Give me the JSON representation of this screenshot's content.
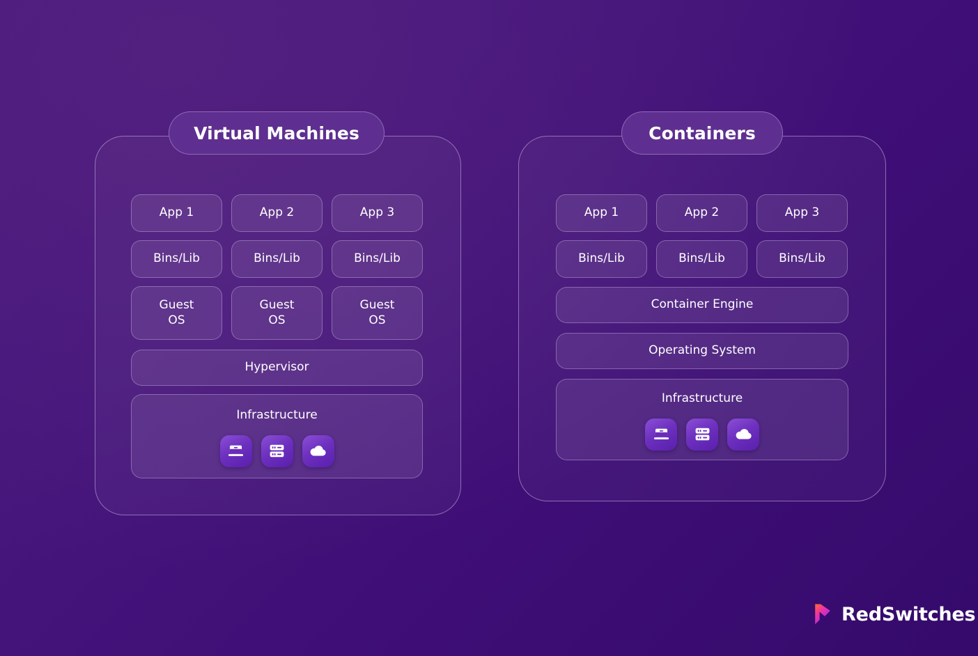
{
  "background": {
    "gradient_from": "#4b1a7e",
    "gradient_to": "#350a6c"
  },
  "panels": [
    {
      "id": "virtual-machines",
      "title": "Virtual Machines",
      "columns": [
        {
          "app": "App 1",
          "bins": "Bins/Lib",
          "guest_os": "Guest\nOS"
        },
        {
          "app": "App 2",
          "bins": "Bins/Lib",
          "guest_os": "Guest\nOS"
        },
        {
          "app": "App 3",
          "bins": "Bins/Lib",
          "guest_os": "Guest\nOS"
        }
      ],
      "hypervisor": "Hypervisor",
      "infrastructure": {
        "label": "Infrastructure",
        "icons": [
          "laptop-icon",
          "server-icon",
          "cloud-icon"
        ]
      }
    },
    {
      "id": "containers",
      "title": "Containers",
      "columns": [
        {
          "app": "App 1",
          "bins": "Bins/Lib"
        },
        {
          "app": "App 2",
          "bins": "Bins/Lib"
        },
        {
          "app": "App 3",
          "bins": "Bins/Lib"
        }
      ],
      "container_engine": "Container Engine",
      "operating_system": "Operating System",
      "infrastructure": {
        "label": "Infrastructure",
        "icons": [
          "laptop-icon",
          "server-icon",
          "cloud-icon"
        ]
      }
    }
  ],
  "brand": {
    "name": "RedSwitches",
    "mark": "redswitches-logo-mark",
    "mark_gradient_from": "#ff6b2c",
    "mark_gradient_mid": "#f0359c",
    "mark_gradient_to": "#3f6bff"
  },
  "vm": {
    "title": "Virtual Machines",
    "app1": "App 1",
    "app2": "App 2",
    "app3": "App 3",
    "bins1": "Bins/Lib",
    "bins2": "Bins/Lib",
    "bins3": "Bins/Lib",
    "guest1": "Guest OS",
    "guest2": "Guest OS",
    "guest3": "Guest OS",
    "hypervisor": "Hypervisor",
    "infra_label": "Infrastructure"
  },
  "ct": {
    "title": "Containers",
    "app1": "App 1",
    "app2": "App 2",
    "app3": "App 3",
    "bins1": "Bins/Lib",
    "bins2": "Bins/Lib",
    "bins3": "Bins/Lib",
    "engine": "Container Engine",
    "os": "Operating System",
    "infra_label": "Infrastructure"
  }
}
